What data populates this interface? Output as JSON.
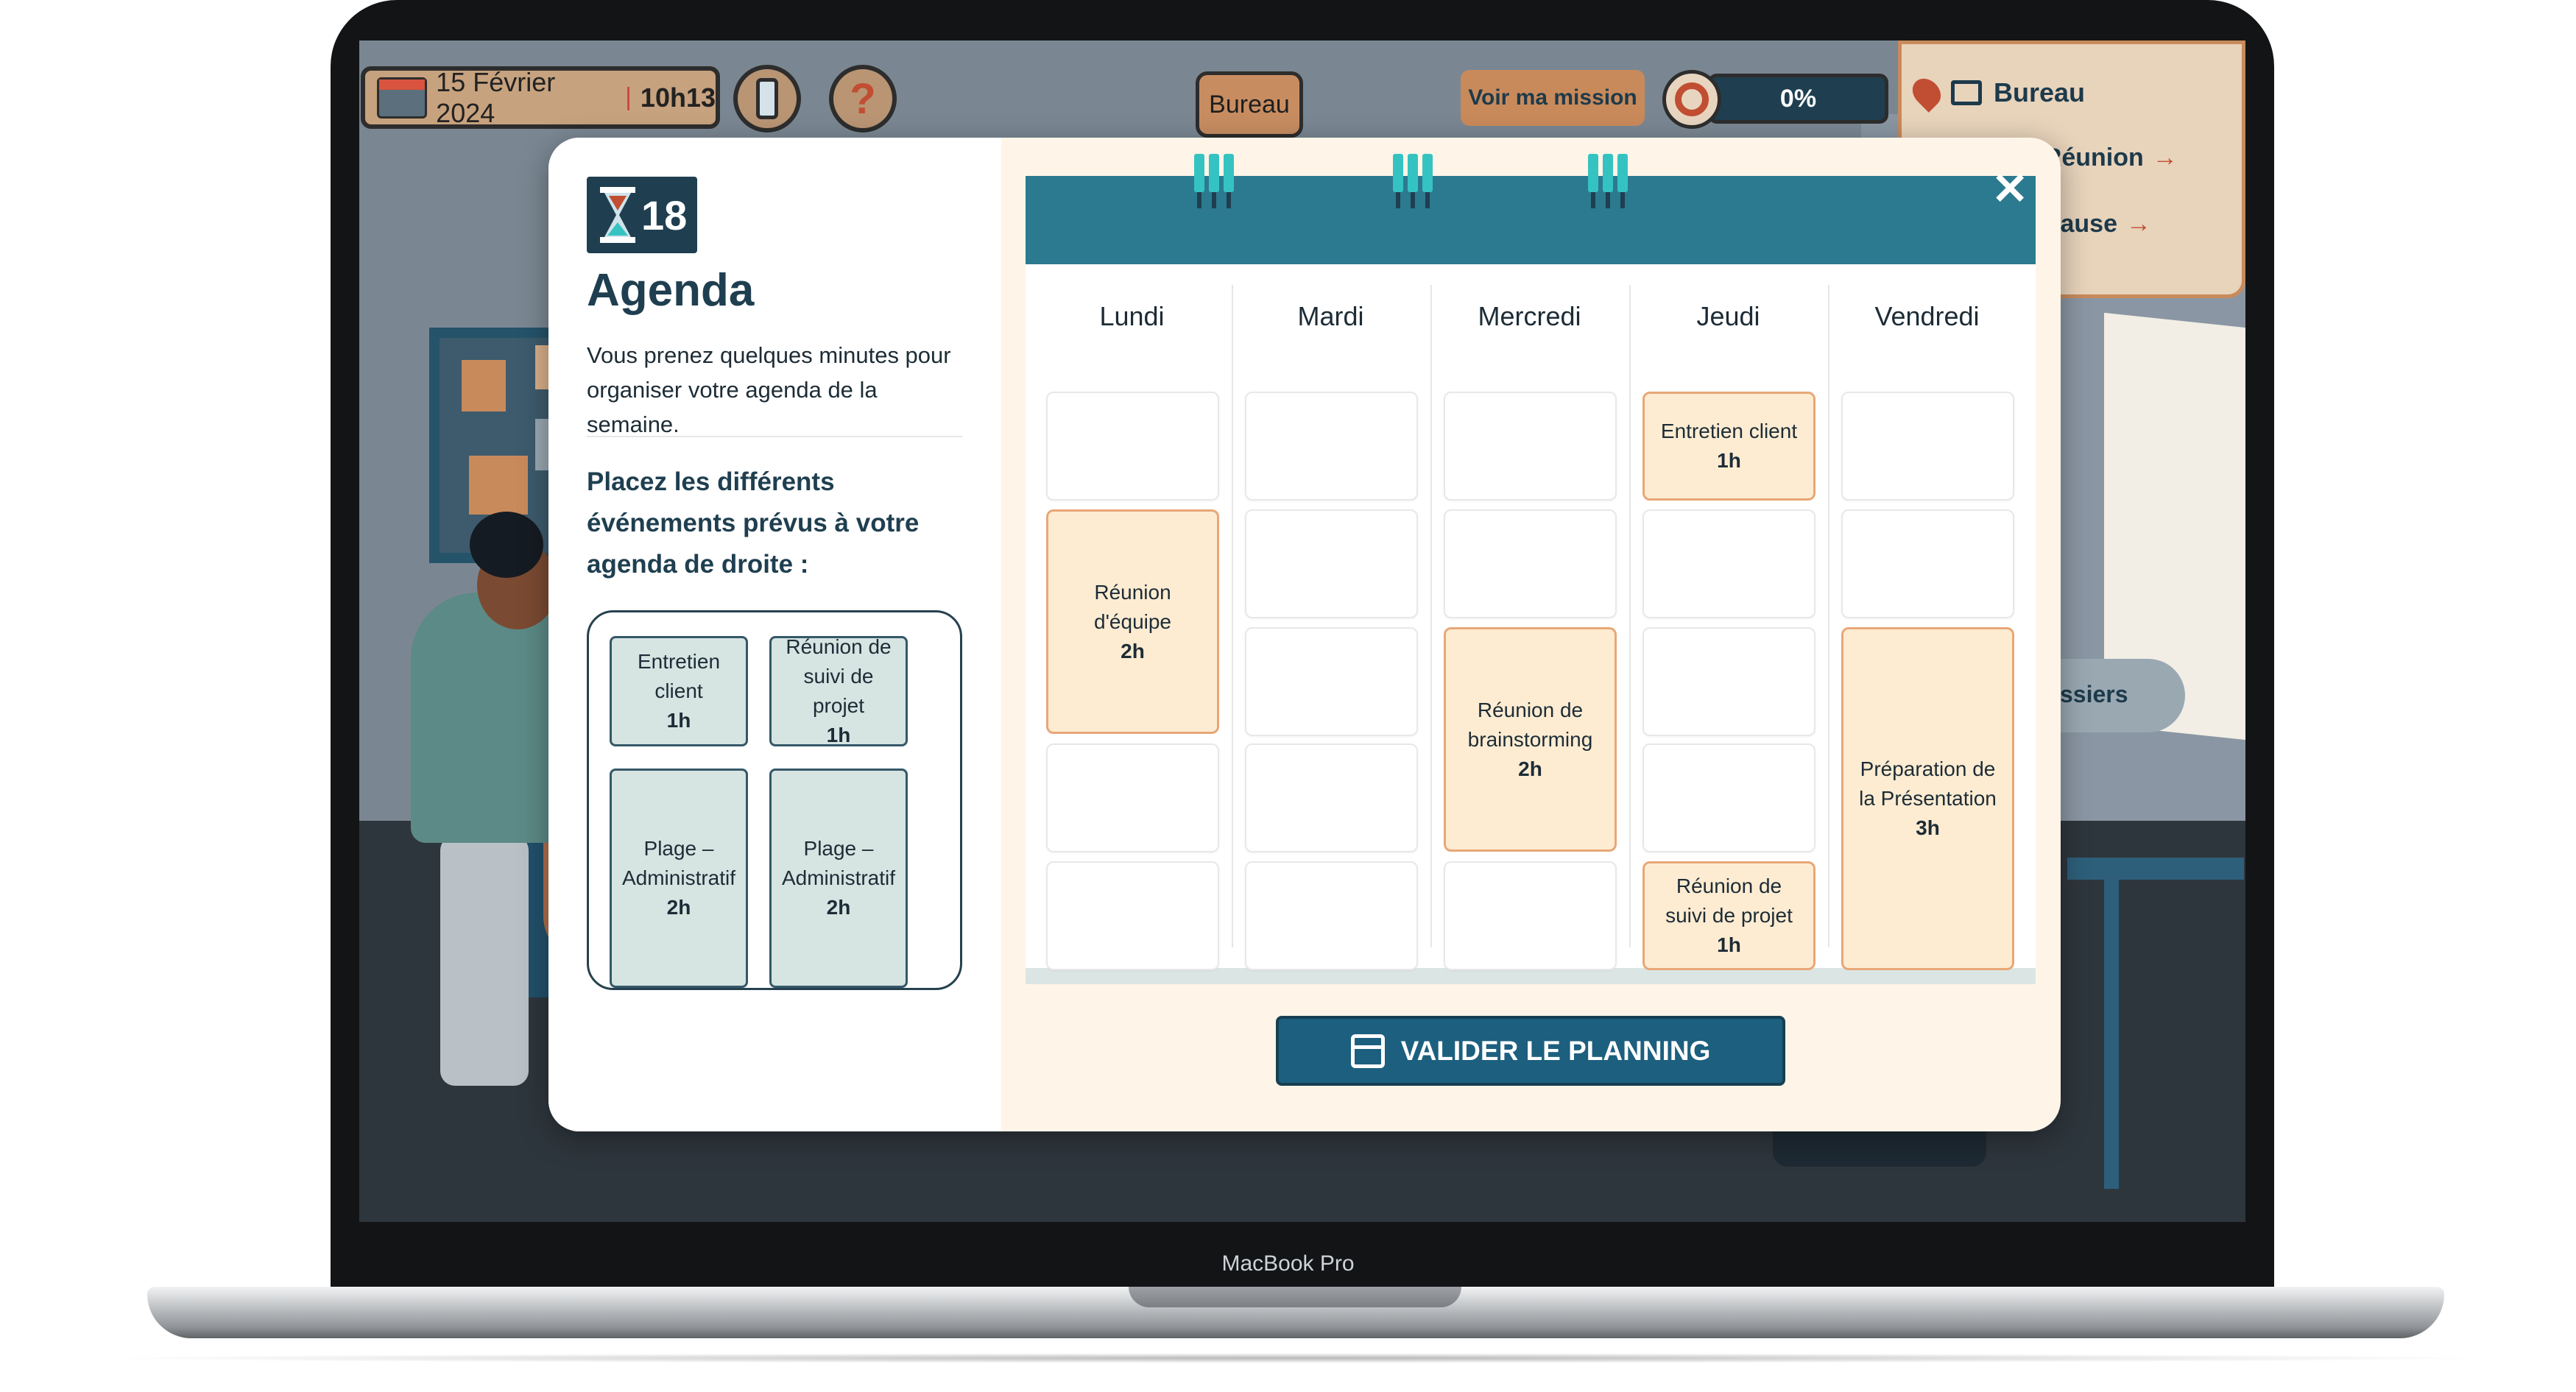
{
  "hud": {
    "date": "15 Février 2024",
    "separator": "|",
    "time": "10h13",
    "help_symbol": "?",
    "location_button": "Bureau",
    "mission_button": "Voir ma mission",
    "progress": "0%",
    "progress_value": 0
  },
  "location_panel": {
    "current": "Bureau",
    "links": [
      {
        "label": "le Réunion",
        "arrow": "→"
      },
      {
        "label": "le Pause",
        "arrow": "→"
      }
    ]
  },
  "background": {
    "dossiers_pill": "ssiers"
  },
  "device_label": "MacBook Pro",
  "modal": {
    "timer": "18",
    "title": "Agenda",
    "description": "Vous prenez quelques minutes pour organiser votre agenda de la semaine.",
    "instruction": "Placez les différents événements prévus à votre agenda de droite :",
    "close_symbol": "✕",
    "pool": [
      {
        "title": "Entretien client",
        "duration": "1h"
      },
      {
        "title": "Réunion de suivi de projet",
        "duration": "1h"
      },
      {
        "title": "Plage – Administratif",
        "duration": "2h"
      },
      {
        "title": "Plage – Administratif",
        "duration": "2h"
      }
    ],
    "days": [
      "Lundi",
      "Mardi",
      "Mercredi",
      "Jeudi",
      "Vendredi"
    ],
    "events": [
      {
        "day": "Lundi",
        "title": "Réunion d'équipe",
        "duration": "2h"
      },
      {
        "day": "Mercredi",
        "title": "Réunion de brainstorming",
        "duration": "2h"
      },
      {
        "day": "Jeudi",
        "title": "Entretien client",
        "duration": "1h"
      },
      {
        "day": "Jeudi",
        "title": "Réunion de suivi de projet",
        "duration": "1h"
      },
      {
        "day": "Vendredi",
        "title": "Préparation de la Présentation",
        "duration": "3h"
      }
    ],
    "validate_button": "VALIDER LE PLANNING"
  }
}
